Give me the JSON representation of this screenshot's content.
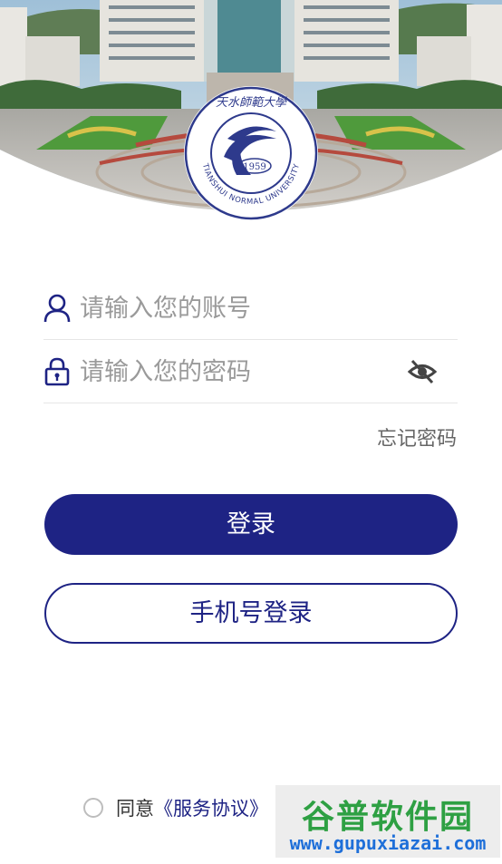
{
  "header": {
    "image_alt": "campus-photo"
  },
  "seal": {
    "chinese_name": "天水師範大學",
    "english_name": "TIANSHUI NORMAL UNIVERSITY",
    "year": "1959"
  },
  "login": {
    "account_placeholder": "请输入您的账号",
    "password_placeholder": "请输入您的密码",
    "forgot_password": "忘记密码",
    "login_button": "登录",
    "phone_login_button": "手机号登录"
  },
  "agreement": {
    "agree_text": "同意",
    "service_link": "《服务协议》"
  },
  "watermark": {
    "title": "谷普软件园",
    "url": "www.gupuxiazai.com"
  },
  "colors": {
    "primary": "#1e2384",
    "placeholder": "#9a9a9a"
  },
  "icons": {
    "account": "user-icon",
    "password": "lock-icon",
    "toggle": "eye-off-icon"
  }
}
